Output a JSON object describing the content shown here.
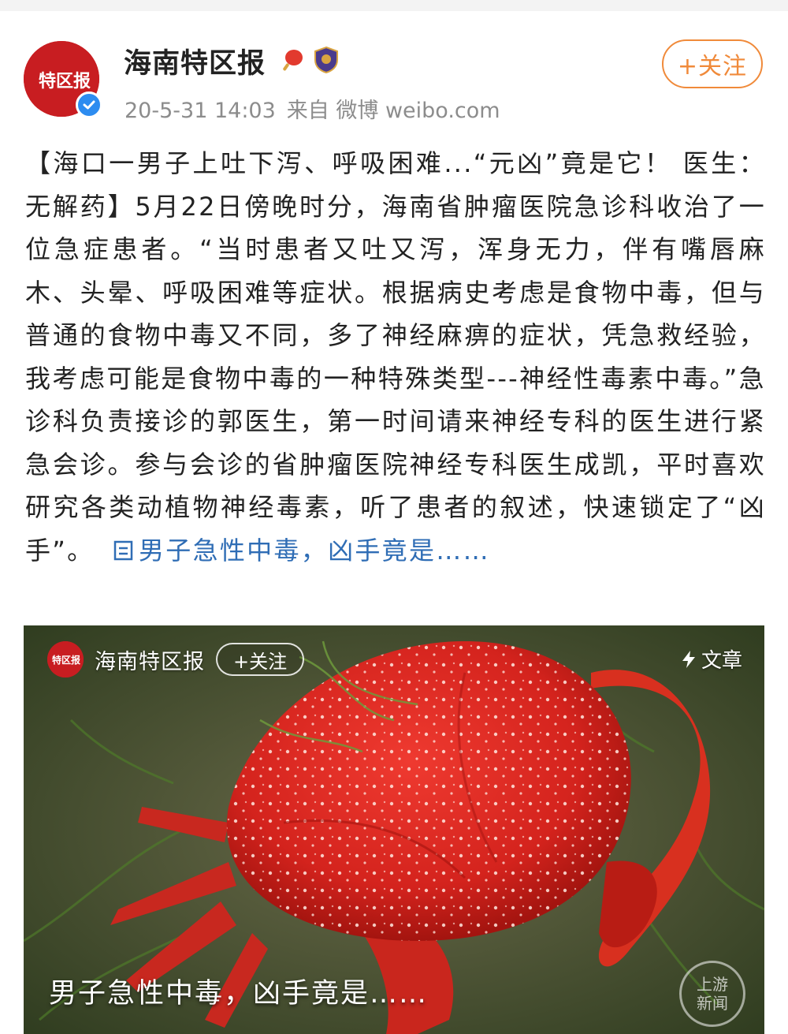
{
  "account": {
    "name": "海南特区报",
    "avatar_text": "特区报",
    "timestamp": "20-5-31 14:03",
    "source": "来自 微博 weibo.com",
    "follow_label": "+关注"
  },
  "post": {
    "text": "【海口一男子上吐下泻、呼吸困难...“元凶”竟是它！ 医生：无解药】5月22日傍晚时分，海南省肿瘤医院急诊科收治了一位急症患者。“当时患者又吐又泻，浑身无力，伴有嘴唇麻木、头晕、呼吸困难等症状。根据病史考虑是食物中毒，但与普通的食物中毒又不同，多了神经麻痹的症状，凭急救经验，我考虑可能是食物中毒的一种特殊类型---神经性毒素中毒。”急诊科负责接诊的郭医生，第一时间请来神经专科的医生进行紧急会诊。参与会诊的省肿瘤医院神经专科医生成凯，平时喜欢研究各类动植物神经毒素，听了患者的叙述，快速锁定了“凶手”。",
    "link_text": "男子急性中毒，凶手竟是……"
  },
  "card": {
    "account_name": "海南特区报",
    "follow_label": "+关注",
    "tag": "文章",
    "caption": "男子急性中毒，凶手竟是……"
  },
  "watermark": {
    "line1": "上游",
    "line2": "新闻"
  },
  "colors": {
    "follow": "#f08a3a",
    "link": "#2f6db5",
    "brand_red": "#c81d21",
    "verified": "#2d8cf0"
  }
}
